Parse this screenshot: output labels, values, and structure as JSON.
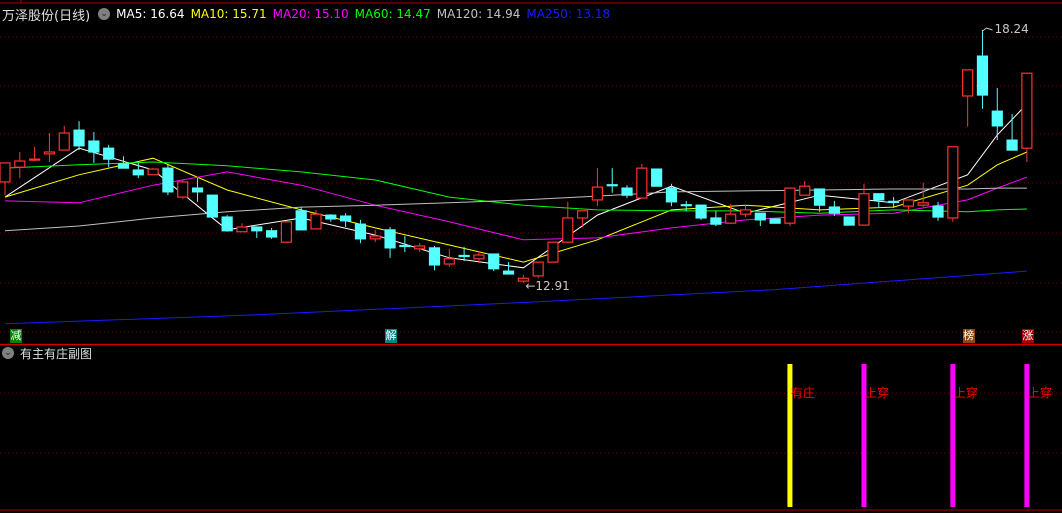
{
  "header": {
    "title": "万泽股份(日线)",
    "indicators": [
      {
        "label": "MA5: 16.64",
        "color": "#ffffff"
      },
      {
        "label": "MA10: 15.71",
        "color": "#ffff00"
      },
      {
        "label": "MA20: 15.10",
        "color": "#ff00ff"
      },
      {
        "label": "MA60: 14.47",
        "color": "#00ff00"
      },
      {
        "label": "MA120: 14.94",
        "color": "#c0c0c0"
      },
      {
        "label": "MA250: 13.18",
        "color": "#1a1aff"
      }
    ]
  },
  "sub_panel": {
    "title": "有主有庄副图",
    "signals": [
      {
        "candle": 53,
        "label": "有庄",
        "color": "#ffff00"
      },
      {
        "candle": 58,
        "label": "上穿",
        "color": "#ff00ff"
      },
      {
        "candle": 64,
        "label": "上穿",
        "color": "#ff00ff"
      },
      {
        "candle": 69,
        "label": "上穿",
        "color": "#ff00ff"
      }
    ]
  },
  "markers": [
    {
      "candle": 0,
      "label": "减",
      "color": "#008000"
    },
    {
      "candle": 26,
      "label": "解",
      "color": "#008080"
    },
    {
      "candle": 65,
      "label": "榜",
      "color": "#8b4513"
    },
    {
      "candle": 69,
      "label": "涨",
      "color": "#a00000"
    }
  ],
  "chart_data": {
    "type": "candlestick",
    "title": "万泽股份(日线)",
    "ylim": [
      11.8,
      18.87
    ],
    "annotations": {
      "high": {
        "candle": 66,
        "label": "18.24"
      },
      "low": {
        "candle": 35,
        "label": "12.91"
      }
    },
    "colors": {
      "up": "#ff3232",
      "down": "#54ffff"
    },
    "candles": [
      [
        15.04,
        15.44,
        14.76,
        15.44
      ],
      [
        15.35,
        15.67,
        15.12,
        15.48
      ],
      [
        15.5,
        15.78,
        15.48,
        15.52
      ],
      [
        15.63,
        16.07,
        15.46,
        15.67
      ],
      [
        15.71,
        16.22,
        15.71,
        16.07
      ],
      [
        16.13,
        16.32,
        15.71,
        15.8
      ],
      [
        15.9,
        16.09,
        15.44,
        15.67
      ],
      [
        15.75,
        15.82,
        15.35,
        15.52
      ],
      [
        15.42,
        15.58,
        15.33,
        15.33
      ],
      [
        15.29,
        15.44,
        15.12,
        15.19
      ],
      [
        15.19,
        15.33,
        15.19,
        15.31
      ],
      [
        15.33,
        15.4,
        14.76,
        14.83
      ],
      [
        14.72,
        15.08,
        14.68,
        15.04
      ],
      [
        14.91,
        15.12,
        14.62,
        14.83
      ],
      [
        14.76,
        14.76,
        14.3,
        14.3
      ],
      [
        14.3,
        14.34,
        13.99,
        14.01
      ],
      [
        13.99,
        14.17,
        13.99,
        14.09
      ],
      [
        14.09,
        14.09,
        13.86,
        14.01
      ],
      [
        14.01,
        14.07,
        13.84,
        13.88
      ],
      [
        13.77,
        14.2,
        13.77,
        14.2
      ],
      [
        14.43,
        14.51,
        14.03,
        14.03
      ],
      [
        14.05,
        14.45,
        14.05,
        14.36
      ],
      [
        14.34,
        14.36,
        14.2,
        14.26
      ],
      [
        14.32,
        14.38,
        14.09,
        14.22
      ],
      [
        14.15,
        14.24,
        13.75,
        13.84
      ],
      [
        13.84,
        14.03,
        13.77,
        13.9
      ],
      [
        14.03,
        14.09,
        13.44,
        13.65
      ],
      [
        13.7,
        13.9,
        13.56,
        13.69
      ],
      [
        13.63,
        13.75,
        13.56,
        13.69
      ],
      [
        13.65,
        13.69,
        13.18,
        13.29
      ],
      [
        13.31,
        13.63,
        13.25,
        13.42
      ],
      [
        13.49,
        13.67,
        13.37,
        13.48
      ],
      [
        13.42,
        13.58,
        13.33,
        13.5
      ],
      [
        13.52,
        13.52,
        13.16,
        13.21
      ],
      [
        13.16,
        13.35,
        13.1,
        13.1
      ],
      [
        12.95,
        13.08,
        12.91,
        13.01
      ],
      [
        13.06,
        13.35,
        13.01,
        13.35
      ],
      [
        13.35,
        13.77,
        13.35,
        13.77
      ],
      [
        13.77,
        14.62,
        13.77,
        14.28
      ],
      [
        14.28,
        14.43,
        14.09,
        14.43
      ],
      [
        14.66,
        15.33,
        14.53,
        14.93
      ],
      [
        14.98,
        15.33,
        14.81,
        14.97
      ],
      [
        14.91,
        14.97,
        14.7,
        14.76
      ],
      [
        14.7,
        15.42,
        14.7,
        15.33
      ],
      [
        15.31,
        15.31,
        14.95,
        14.95
      ],
      [
        14.91,
        15.0,
        14.53,
        14.62
      ],
      [
        14.56,
        14.64,
        14.43,
        14.55
      ],
      [
        14.55,
        14.55,
        14.24,
        14.28
      ],
      [
        14.28,
        14.43,
        14.11,
        14.15
      ],
      [
        14.17,
        14.57,
        14.17,
        14.36
      ],
      [
        14.36,
        14.55,
        14.3,
        14.45
      ],
      [
        14.38,
        14.38,
        14.11,
        14.24
      ],
      [
        14.26,
        14.26,
        14.17,
        14.17
      ],
      [
        14.17,
        14.91,
        14.11,
        14.91
      ],
      [
        14.76,
        15.06,
        14.76,
        14.95
      ],
      [
        14.89,
        14.89,
        14.41,
        14.55
      ],
      [
        14.51,
        14.64,
        14.32,
        14.38
      ],
      [
        14.3,
        14.3,
        14.13,
        14.13
      ],
      [
        14.13,
        15.0,
        14.13,
        14.79
      ],
      [
        14.79,
        14.79,
        14.51,
        14.66
      ],
      [
        14.63,
        14.72,
        14.49,
        14.62
      ],
      [
        14.53,
        14.66,
        14.38,
        14.66
      ],
      [
        14.55,
        15.02,
        14.51,
        14.6
      ],
      [
        14.53,
        14.62,
        14.22,
        14.3
      ],
      [
        14.28,
        15.78,
        14.2,
        15.78
      ],
      [
        16.85,
        17.4,
        16.2,
        17.4
      ],
      [
        17.69,
        18.24,
        16.58,
        16.87
      ],
      [
        16.53,
        17.02,
        15.92,
        16.22
      ],
      [
        15.92,
        16.47,
        15.71,
        15.71
      ],
      [
        15.75,
        17.33,
        15.46,
        17.33
      ]
    ],
    "ma_sample_index": [
      0,
      5,
      10,
      15,
      20,
      25,
      30,
      35,
      40,
      45,
      50,
      55,
      60,
      65,
      67,
      69
    ],
    "moving_averages": [
      {
        "name": "MA5",
        "color": "#ffffff",
        "values": [
          14.72,
          15.75,
          15.29,
          14.03,
          14.28,
          13.92,
          13.44,
          13.23,
          14.34,
          14.95,
          14.38,
          14.76,
          14.6,
          15.19,
          16.03,
          16.68
        ]
      },
      {
        "name": "MA10",
        "color": "#ffff00",
        "values": [
          14.72,
          15.19,
          15.54,
          14.87,
          14.45,
          14.07,
          13.71,
          13.35,
          13.82,
          14.45,
          14.55,
          14.45,
          14.51,
          14.97,
          15.4,
          15.67
        ]
      },
      {
        "name": "MA20",
        "color": "#ff00ff",
        "values": [
          14.64,
          14.6,
          14.97,
          15.25,
          14.97,
          14.55,
          14.2,
          13.82,
          13.86,
          14.07,
          14.24,
          14.34,
          14.38,
          14.66,
          14.91,
          15.14
        ]
      },
      {
        "name": "MA60",
        "color": "#00ff00",
        "values": [
          15.33,
          15.4,
          15.46,
          15.38,
          15.25,
          15.08,
          14.72,
          14.55,
          14.45,
          14.43,
          14.43,
          14.38,
          14.45,
          14.41,
          14.45,
          14.47
        ]
      },
      {
        "name": "MA120",
        "color": "#c0c0c0",
        "values": [
          14.01,
          14.11,
          14.28,
          14.41,
          14.51,
          14.55,
          14.6,
          14.66,
          14.74,
          14.83,
          14.85,
          14.87,
          14.89,
          14.89,
          14.91,
          14.91
        ]
      },
      {
        "name": "MA250",
        "color": "#1a1aff",
        "sample_index": [
          0,
          17,
          35,
          52,
          69
        ],
        "values": [
          12.05,
          12.24,
          12.5,
          12.77,
          13.16
        ]
      }
    ]
  }
}
